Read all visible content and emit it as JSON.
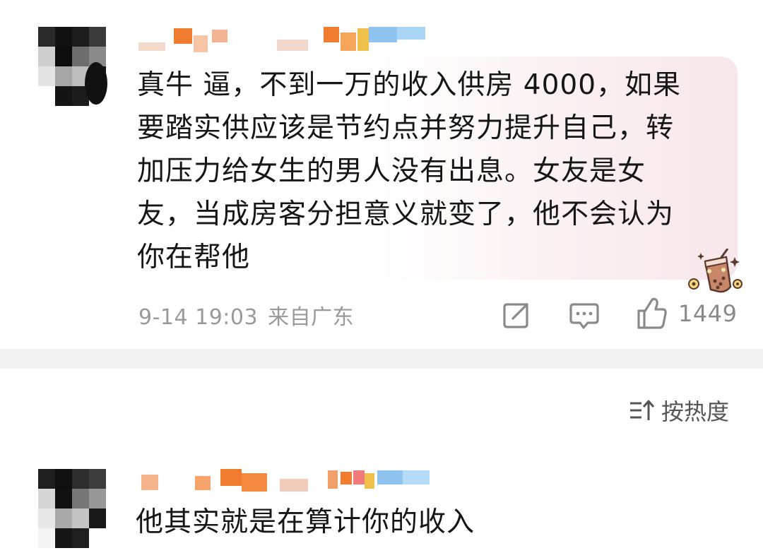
{
  "comments": [
    {
      "text": "真牛 逼，不到一万的收入供房4000，如果要踏实供应该是节约点并努力提升自己，转加压力给女生的男人没有出息。女友是女友，当成房客分担意义就变了，他不会认为你在帮他",
      "text_lines": [
        "真牛 逼，不到一万的收入供房 4000，如果",
        "要踏实供应该是节约点并努力提升自己，转",
        "加压力给女生的男人没有出息。女友是女",
        "友，当成房客分担意义就变了，他不会认为",
        "你在帮他"
      ],
      "time": "9-14 19:03",
      "location": "来自广东",
      "like_count": "1449"
    },
    {
      "text": "他其实就是在算计你的收入"
    }
  ],
  "sort": {
    "label": "按热度"
  },
  "icons": {
    "share": "share-icon",
    "comment": "comment-icon",
    "like": "thumbs-up-icon",
    "sort": "sort-icon",
    "sticker": "bubble-tea-sticker"
  },
  "colors": {
    "text": "#161616",
    "meta": "#9a9a9a",
    "divider": "#f2f2f2",
    "bubble_tint": "#f7e6ea"
  }
}
